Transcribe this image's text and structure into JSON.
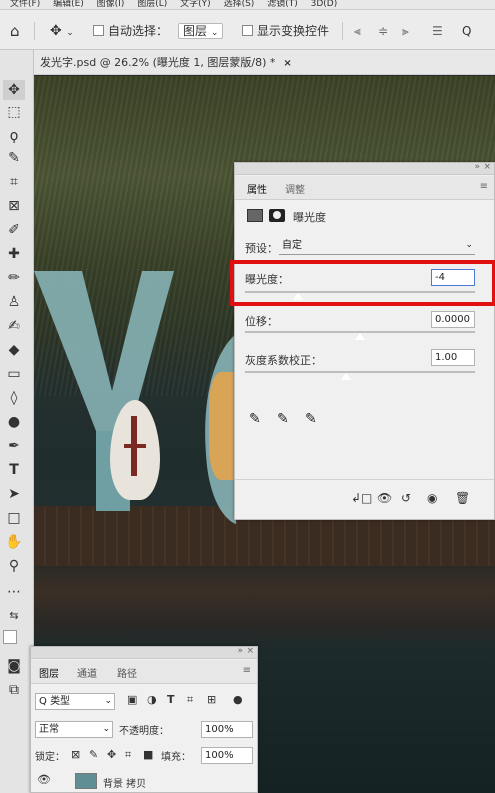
{
  "menubar": {
    "items": [
      "文件(F)",
      "编辑(E)",
      "图像(I)",
      "图层(L)",
      "文字(Y)",
      "选择(S)",
      "滤镜(T)",
      "3D(D)"
    ]
  },
  "options": {
    "auto_select_label": "自动选择：",
    "layer_select": "图层",
    "show_transform_label": "显示变换控件",
    "home_icon": "home-icon",
    "move_icon": "move-icon"
  },
  "document": {
    "tab_title": "发光字.psd @ 26.2% (曝光度 1, 图层蒙版/8) *",
    "close": "×"
  },
  "properties": {
    "tabs": [
      "属性",
      "调整"
    ],
    "title": "曝光度",
    "preset_label": "预设：",
    "preset_value": "自定",
    "exposure_label": "曝光度：",
    "exposure_value": "-4",
    "offset_label": "位移：",
    "offset_value": "0.0000",
    "gamma_label": "灰度系数校正：",
    "gamma_value": "1.00",
    "sliders": {
      "exposure": 0.23,
      "offset": 0.5,
      "gamma": 0.44
    }
  },
  "layers": {
    "tabs": [
      "图层",
      "通道",
      "路径"
    ],
    "filter_label": "类型",
    "blend_mode": "正常",
    "opacity_label": "不透明度：",
    "opacity_value": "100%",
    "lock_label": "锁定：",
    "fill_label": "填充：",
    "fill_value": "100%",
    "layer_name": "背景 拷贝"
  },
  "colors": {
    "highlight": "#e01010",
    "canvas_text": "#8fb7b7"
  }
}
